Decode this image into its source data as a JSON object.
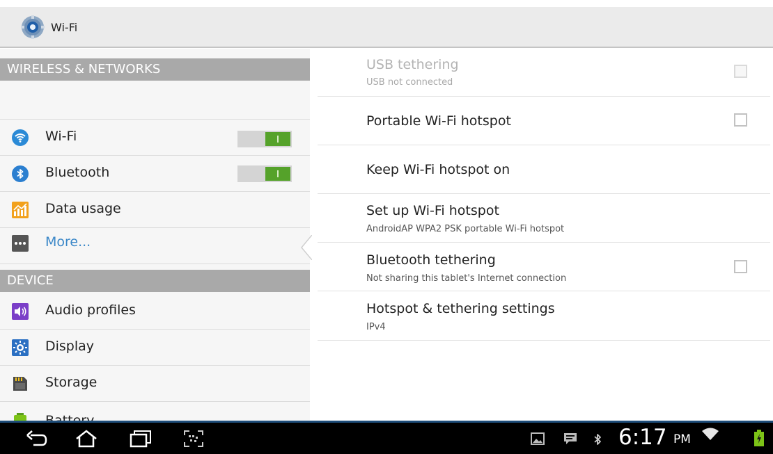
{
  "action_bar": {
    "title": "Wi-Fi",
    "icon": "settings-gear-icon"
  },
  "left_pane": {
    "sections": [
      {
        "header": "WIRELESS & NETWORKS",
        "items": [
          {
            "label": "Wi-Fi",
            "icon": "wifi-icon",
            "toggle": "on"
          },
          {
            "label": "Bluetooth",
            "icon": "bluetooth-icon",
            "toggle": "on"
          },
          {
            "label": "Data usage",
            "icon": "data-usage-icon"
          },
          {
            "label": "More...",
            "icon": "more-icon",
            "selected": true
          }
        ]
      },
      {
        "header": "DEVICE",
        "items": [
          {
            "label": "Audio profiles",
            "icon": "audio-profiles-icon"
          },
          {
            "label": "Display",
            "icon": "display-icon"
          },
          {
            "label": "Storage",
            "icon": "storage-icon"
          },
          {
            "label": "Battery",
            "icon": "battery-icon"
          }
        ]
      }
    ]
  },
  "right_pane": {
    "rows": [
      {
        "title": "USB tethering",
        "summary": "USB not connected",
        "checkbox": false,
        "enabled": false
      },
      {
        "title": "Portable Wi-Fi hotspot",
        "checkbox": false,
        "enabled": true
      },
      {
        "title": "Keep Wi-Fi hotspot on",
        "enabled": true
      },
      {
        "title": "Set up Wi-Fi hotspot",
        "summary": "AndroidAP WPA2 PSK portable Wi-Fi hotspot",
        "enabled": true
      },
      {
        "title": "Bluetooth tethering",
        "summary": "Not sharing this tablet's Internet connection",
        "checkbox": false,
        "enabled": true
      },
      {
        "title": "Hotspot & tethering settings",
        "summary": "IPv4",
        "enabled": true
      }
    ]
  },
  "system_bar": {
    "nav_buttons": [
      "back-icon",
      "home-icon",
      "recent-apps-icon",
      "screenshot-icon"
    ],
    "status_icons": [
      "gallery-notification-icon",
      "message-notification-icon",
      "bluetooth-status-icon",
      "wifi-signal-icon",
      "battery-charging-icon"
    ],
    "clock": "6:17",
    "ampm": "PM"
  },
  "colors": {
    "section_header": "#a9a9a9",
    "toggle_on": "#55a22a",
    "selected_text": "#3a87c8",
    "battery": "#7dc317"
  }
}
